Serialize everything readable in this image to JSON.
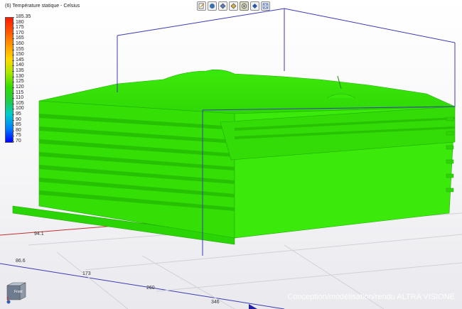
{
  "toolbar": {
    "buttons": [
      {
        "icon": "edit-note-icon",
        "active": false
      },
      {
        "icon": "shaded-sphere-icon",
        "active": false
      },
      {
        "icon": "diamond-icon",
        "active": false
      },
      {
        "icon": "view-diamond-icon",
        "active": false
      },
      {
        "icon": "target-circle-icon",
        "active": true
      },
      {
        "icon": "solid-render-icon",
        "active": false
      },
      {
        "icon": "fit-view-icon",
        "active": false
      }
    ]
  },
  "legend": {
    "title": "(6) Température statique - Celsius",
    "ticks": [
      "185.35",
      "180",
      "175",
      "170",
      "165",
      "160",
      "155",
      "150",
      "145",
      "140",
      "135",
      "130",
      "125",
      "120",
      "115",
      "110",
      "105",
      "100",
      "95",
      "90",
      "85",
      "80",
      "75",
      "70"
    ],
    "colors": [
      "#ff1a00",
      "#ff5500",
      "#ff9900",
      "#ffd800",
      "#a8e800",
      "#33dd00",
      "#22cc44",
      "#00cccc",
      "#0080ff",
      "#0000ff"
    ]
  },
  "axes": {
    "labels": [
      "94.1",
      "86.6",
      "173",
      "260",
      "346"
    ]
  },
  "view_cube": {
    "face_label": "Front"
  },
  "model_color": "#33e600",
  "credits": "Conception/modélisation/rendu ALTRA VISIONE"
}
